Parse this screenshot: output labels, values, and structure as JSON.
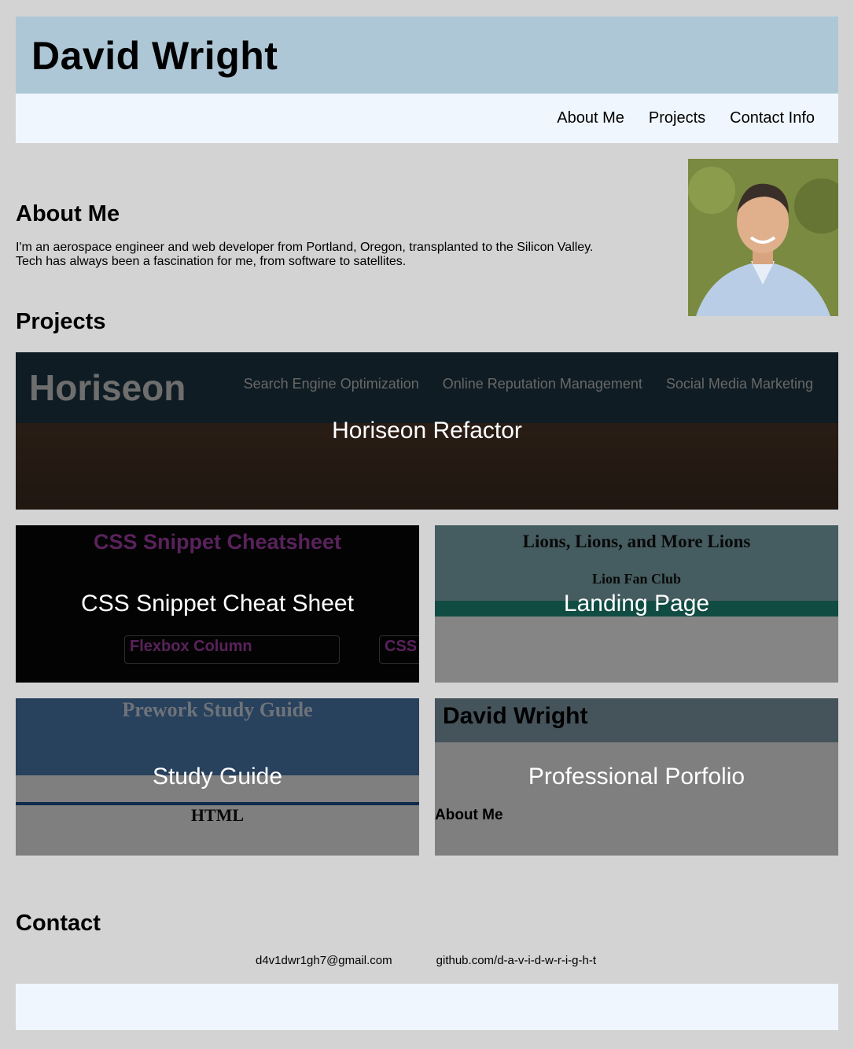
{
  "header": {
    "title": "David Wright"
  },
  "nav": {
    "items": [
      "About Me",
      "Projects",
      "Contact Info"
    ]
  },
  "about": {
    "heading": "About Me",
    "line1": "I'm an aerospace engineer and web developer from Portland, Oregon, transplanted to the Silicon Valley.",
    "line2": "Tech has always been a fascination for me, from software to satellites."
  },
  "projects": {
    "heading": "Projects",
    "items": [
      {
        "caption": "Horiseon Refactor",
        "preview": {
          "brand": "Horiseon",
          "links": [
            "Search Engine Optimization",
            "Online Reputation Management",
            "Social Media Marketing"
          ]
        }
      },
      {
        "caption": "CSS Snippet Cheat Sheet",
        "preview": {
          "title": "CSS Snippet Cheatsheet",
          "box1": "Flexbox Column",
          "box2": "CSS"
        }
      },
      {
        "caption": "Landing Page",
        "preview": {
          "title": "Lions, Lions, and More Lions",
          "subtitle": "Lion Fan Club"
        }
      },
      {
        "caption": "Study Guide",
        "preview": {
          "title": "Prework Study Guide",
          "subtitle": "HTML"
        }
      },
      {
        "caption": "Professional Porfolio",
        "preview": {
          "title": "David Wright",
          "subtitle": "About Me"
        }
      }
    ]
  },
  "contact": {
    "heading": "Contact",
    "email": "d4v1dwr1gh7@gmail.com",
    "github": "github.com/d-a-v-i-d-w-r-i-g-h-t"
  },
  "colors": {
    "page_bg": "#d3d3d3",
    "header_bg": "#aec7d7",
    "nav_bg": "#eff6fe"
  }
}
